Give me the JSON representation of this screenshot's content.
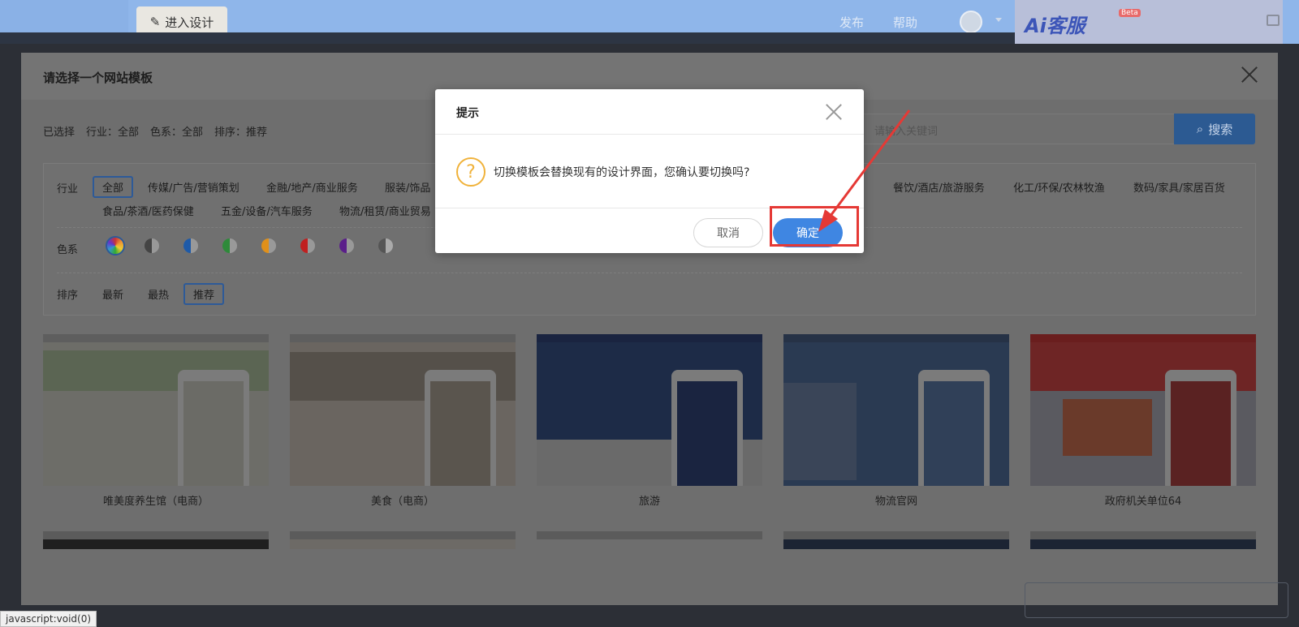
{
  "topbar": {
    "enter_design": "进入设计",
    "publish": "发布",
    "help": "帮助",
    "brand": "Ai客服",
    "brand_badge": "Beta"
  },
  "main_dialog": {
    "title": "请选择一个网站模板",
    "selected_prefix": "已选择",
    "selected_industry": "行业：全部",
    "selected_color": "色系：全部",
    "selected_sort": "排序：推荐",
    "search_placeholder": "请输入关键词",
    "search_button": "搜索",
    "industry_label": "行业",
    "industries_row1": [
      "全部",
      "传媒/广告/营销策划",
      "金融/地产/商业服务",
      "服装/饰品",
      "餐饮/酒店/旅游服务",
      "化工/环保/农林牧渔",
      "数码/家具/家居百货"
    ],
    "industries_row2": [
      "食品/茶酒/医药保健",
      "五金/设备/汽车服务",
      "物流/租赁/商业贸易"
    ],
    "color_label": "色系",
    "color_swatches": [
      "#c84a8a",
      "#444444",
      "#1e5aa8",
      "#2e8a3a",
      "#e0901a",
      "#c02020",
      "#5a1e8a",
      "#555555"
    ],
    "sort_label": "排序",
    "sorts": [
      "最新",
      "最热",
      "推荐"
    ],
    "templates": [
      {
        "name": "唯美度养生馆（电商）",
        "bg": "#6d6d68"
      },
      {
        "name": "美食（电商）",
        "bg": "#6a6560"
      },
      {
        "name": "旅游",
        "bg": "#1d2b47"
      },
      {
        "name": "物流官网",
        "bg": "#2a3a52"
      },
      {
        "name": "政府机关单位64",
        "bg": "#5a3a3a"
      }
    ]
  },
  "confirm": {
    "title": "提示",
    "message": "切换模板会替换现有的设计界面，您确认要切换吗?",
    "cancel": "取消",
    "ok": "确定"
  },
  "status_tip": "javascript:void(0)"
}
